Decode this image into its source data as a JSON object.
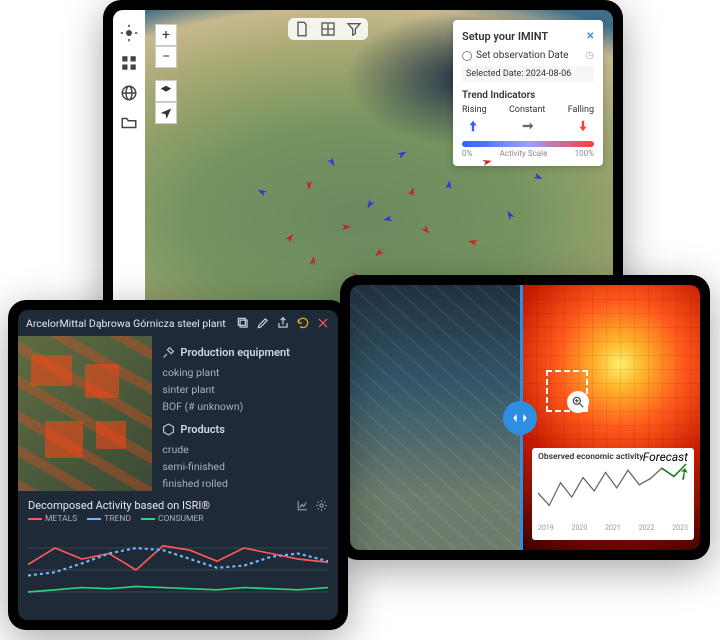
{
  "map": {
    "imint": {
      "title": "Setup your IMINT",
      "set_date_label": "Set observation Date",
      "selected_date_label": "Selected Date: 2024-08-06",
      "trend_header": "Trend Indicators",
      "trend_rising": "Rising",
      "trend_constant": "Constant",
      "trend_falling": "Falling",
      "scale_label": "Activity Scale",
      "scale_min": "0%",
      "scale_max": "100%"
    },
    "markers": [
      {
        "x": 31,
        "y": 60,
        "c": "#c22",
        "d": 40
      },
      {
        "x": 35,
        "y": 46,
        "c": "#c22",
        "d": 180
      },
      {
        "x": 43,
        "y": 57,
        "c": "#c22",
        "d": 90
      },
      {
        "x": 50,
        "y": 64,
        "c": "#c22",
        "d": 230
      },
      {
        "x": 57,
        "y": 48,
        "c": "#c22",
        "d": 20
      },
      {
        "x": 60,
        "y": 58,
        "c": "#c22",
        "d": 135
      },
      {
        "x": 70,
        "y": 61,
        "c": "#c22",
        "d": 280
      },
      {
        "x": 73,
        "y": 40,
        "c": "#c22",
        "d": 75
      },
      {
        "x": 25,
        "y": 48,
        "c": "#33d",
        "d": 300
      },
      {
        "x": 40,
        "y": 40,
        "c": "#33d",
        "d": 150
      },
      {
        "x": 55,
        "y": 38,
        "c": "#33d",
        "d": 60
      },
      {
        "x": 48,
        "y": 51,
        "c": "#33d",
        "d": 210
      },
      {
        "x": 65,
        "y": 46,
        "c": "#33d",
        "d": 10
      },
      {
        "x": 78,
        "y": 54,
        "c": "#33d",
        "d": 330
      },
      {
        "x": 84,
        "y": 44,
        "c": "#33d",
        "d": 115
      },
      {
        "x": 45,
        "y": 70,
        "c": "#c22",
        "d": 95
      },
      {
        "x": 52,
        "y": 55,
        "c": "#33d",
        "d": 260
      },
      {
        "x": 36,
        "y": 66,
        "c": "#c22",
        "d": 10
      }
    ]
  },
  "compare": {
    "chart_title": "Observed economic activity",
    "forecast_label": "Forecast",
    "axis": [
      "2019",
      "2020",
      "2021",
      "2022",
      "2023"
    ]
  },
  "plant": {
    "title": "ArcelorMittal Dąbrowa Górnicza steel plant",
    "equip_header": "Production equipment",
    "equip_items": [
      "coking plant",
      "sinter plant",
      "BOF (# unknown)"
    ],
    "products_header": "Products",
    "product_items": [
      "crude",
      "semi-finished",
      "finished rolled"
    ],
    "decomp_title": "Decomposed Activity based on ISRI®",
    "legend": [
      "METALS",
      "TREND",
      "CONSUMER"
    ]
  },
  "chart_data": [
    {
      "type": "line",
      "title": "Observed economic activity",
      "x": [
        2019,
        2020,
        2021,
        2022,
        2023
      ],
      "values": [
        52,
        40,
        58,
        44,
        60,
        50,
        68,
        55,
        70,
        58,
        64,
        74
      ],
      "ylim": [
        30,
        80
      ],
      "forecast_tail": true
    },
    {
      "type": "line",
      "title": "Decomposed Activity based on ISRI®",
      "series": [
        {
          "name": "METALS",
          "color": "#ff5a5a",
          "values": [
            45,
            60,
            50,
            55,
            40,
            62,
            58,
            48,
            60,
            55,
            50,
            47
          ]
        },
        {
          "name": "TREND",
          "color": "#6fb7ff",
          "values": [
            35,
            38,
            46,
            55,
            60,
            58,
            50,
            42,
            44,
            52,
            55,
            48
          ],
          "style": "dashed"
        },
        {
          "name": "CONSUMER",
          "color": "#2ed573",
          "values": [
            20,
            22,
            24,
            23,
            25,
            24,
            23,
            22,
            24,
            23,
            22,
            24
          ]
        }
      ],
      "ylim": [
        0,
        80
      ]
    }
  ]
}
